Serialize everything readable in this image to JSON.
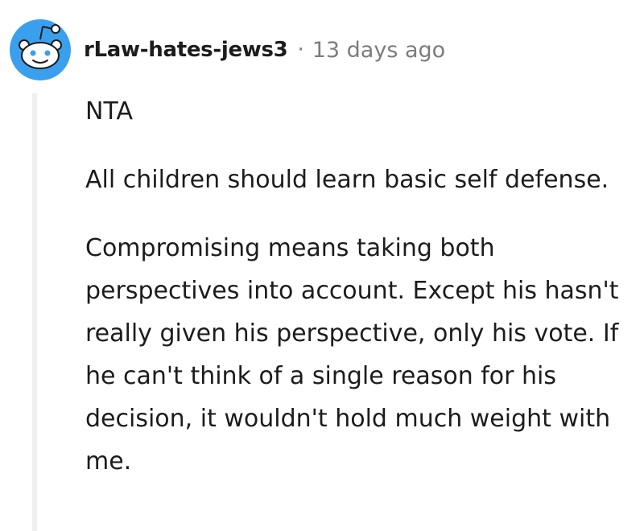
{
  "comment": {
    "author": "rLaw-hates-jews3",
    "separator": "·",
    "timestamp": "13 days ago",
    "paragraphs": [
      "NTA",
      "All children should learn basic self defense.",
      "Compromising means taking both perspectives into account. Except his hasn't really given his perspective, only his vote. If he can't think of a single reason for his decision, it wouldn't hold much weight with me."
    ]
  },
  "colors": {
    "avatar_blue": "#3aa0ed",
    "text": "#1c1c1c",
    "meta": "#7c7c7c",
    "thread_line": "#edeff1"
  },
  "icons": {
    "avatar": "reddit-snoo-icon"
  }
}
